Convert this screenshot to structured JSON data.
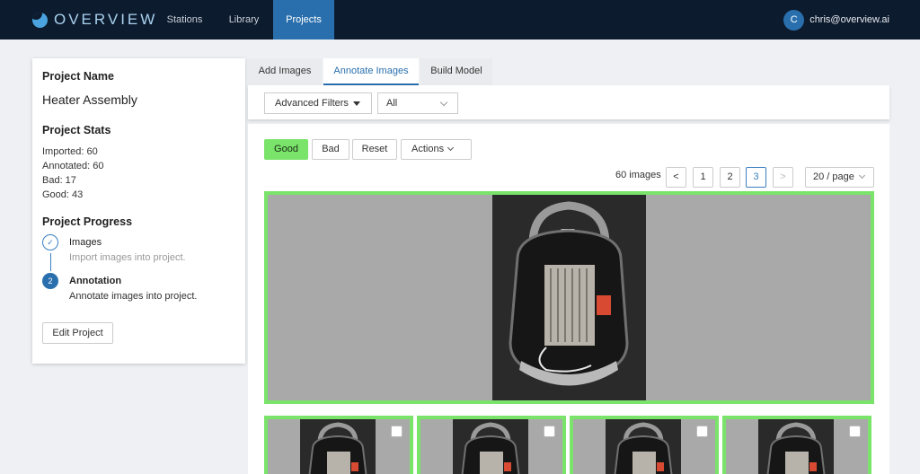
{
  "app": {
    "logo_text": "OVERVIEW",
    "nav": [
      "Stations",
      "Library",
      "Projects"
    ],
    "active_nav": "Projects",
    "user": {
      "initial": "C",
      "email": "chris@overview.ai"
    }
  },
  "project": {
    "name_label": "Project Name",
    "name": "Heater Assembly",
    "stats_label": "Project Stats",
    "stats": [
      "Imported: 60",
      "Annotated: 60",
      "Bad: 17",
      "Good: 43"
    ],
    "progress_label": "Project Progress",
    "steps": [
      {
        "marker": "✓",
        "title": "Images",
        "desc": "Import images into project."
      },
      {
        "marker": "2",
        "title": "Annotation",
        "desc": "Annotate images into project."
      }
    ],
    "edit_label": "Edit Project"
  },
  "tabs": [
    "Add Images",
    "Annotate Images",
    "Build Model"
  ],
  "active_tab": "Annotate Images",
  "filters": {
    "advanced_label": "Advanced Filters",
    "select_value": "All"
  },
  "actions": {
    "good": "Good",
    "bad": "Bad",
    "reset": "Reset",
    "actions": "Actions"
  },
  "pagination": {
    "count_text": "60 images",
    "prev": "<",
    "pages": [
      "1",
      "2",
      "3"
    ],
    "current_page": "3",
    "next": ">",
    "per_page": "20 / page"
  },
  "colors": {
    "nav_bg": "#0d1b2e",
    "accent": "#2a6fad",
    "good_green": "#79e36a"
  }
}
